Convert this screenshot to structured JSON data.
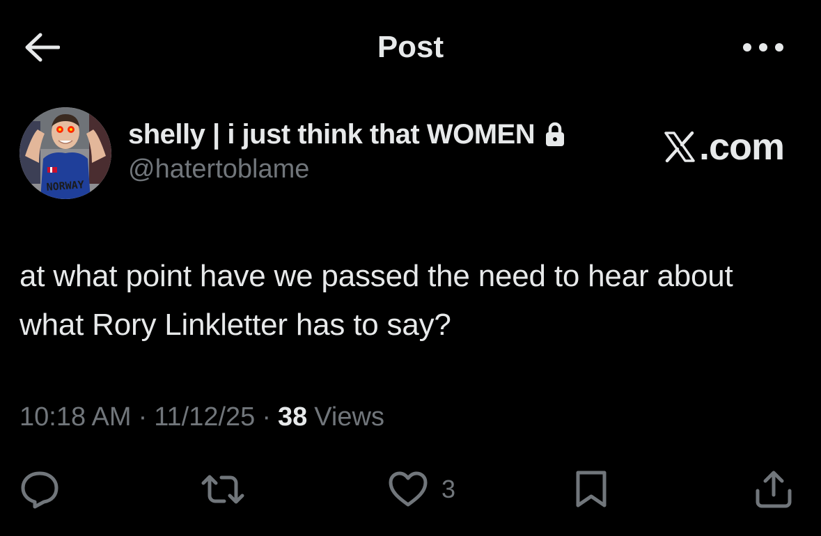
{
  "header": {
    "title": "Post",
    "back_icon": "arrow-left-icon",
    "more_icon": "more-horizontal-icon"
  },
  "author": {
    "display_name": "shelly | i just think that WOMEN",
    "handle": "@hatertoblame",
    "protected_icon": "lock-icon",
    "avatar_text": "NORWAY"
  },
  "watermark": {
    "text": ".com",
    "icon": "x-logo-icon"
  },
  "post": {
    "text": "at what point have we passed the need to hear about what Rory Linkletter has to say?"
  },
  "meta": {
    "time": "10:18 AM",
    "date": "11/12/25",
    "separator": "·",
    "views_count": "38",
    "views_label": "Views"
  },
  "actions": {
    "reply_icon": "reply-icon",
    "repost_icon": "repost-icon",
    "like_icon": "heart-icon",
    "like_count": "3",
    "bookmark_icon": "bookmark-icon",
    "share_icon": "share-icon"
  },
  "colors": {
    "background": "#000000",
    "primary_text": "#e7e9ea",
    "secondary_text": "#71767b"
  }
}
